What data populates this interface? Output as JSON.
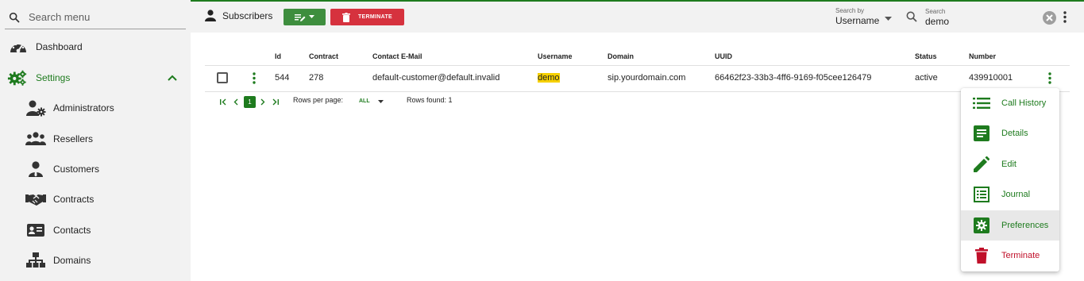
{
  "sidebar": {
    "search_placeholder": "Search menu",
    "items": [
      {
        "label": "Dashboard",
        "icon": "dashboard-icon"
      },
      {
        "label": "Settings",
        "icon": "settings-icon"
      },
      {
        "label": "Administrators",
        "icon": "administrators-icon"
      },
      {
        "label": "Resellers",
        "icon": "resellers-icon"
      },
      {
        "label": "Customers",
        "icon": "customers-icon"
      },
      {
        "label": "Contracts",
        "icon": "contracts-icon"
      },
      {
        "label": "Contacts",
        "icon": "contacts-icon"
      },
      {
        "label": "Domains",
        "icon": "domains-icon"
      }
    ]
  },
  "topbar": {
    "title": "Subscribers",
    "terminate_label": "TERMINATE",
    "search_by_caption": "Search by",
    "search_by_value": "Username",
    "search_caption": "Search",
    "search_value": "demo"
  },
  "table": {
    "columns": [
      "Id",
      "Contract",
      "Contact E-Mail",
      "Username",
      "Domain",
      "UUID",
      "Status",
      "Number"
    ],
    "rows": [
      {
        "id": "544",
        "contract": "278",
        "email": "default-customer@default.invalid",
        "username": "demo",
        "domain": "sip.yourdomain.com",
        "uuid": "66462f23-33b3-4ff6-9169-f05cee126479",
        "status": "active",
        "number": "439910001"
      }
    ]
  },
  "pagination": {
    "current_page": "1",
    "rows_per_page_label": "Rows per page:",
    "rows_per_page_value": "ALL",
    "rows_found": "Rows found: 1"
  },
  "row_menu": {
    "items": [
      {
        "label": "Call History",
        "icon": "list-icon"
      },
      {
        "label": "Details",
        "icon": "details-icon"
      },
      {
        "label": "Edit",
        "icon": "edit-icon"
      },
      {
        "label": "Journal",
        "icon": "journal-icon"
      },
      {
        "label": "Preferences",
        "icon": "preferences-icon"
      },
      {
        "label": "Terminate",
        "icon": "trash-icon"
      }
    ]
  },
  "colors": {
    "accent": "#1e7b1e",
    "danger": "#d6323e",
    "highlight": "#f6d000"
  }
}
